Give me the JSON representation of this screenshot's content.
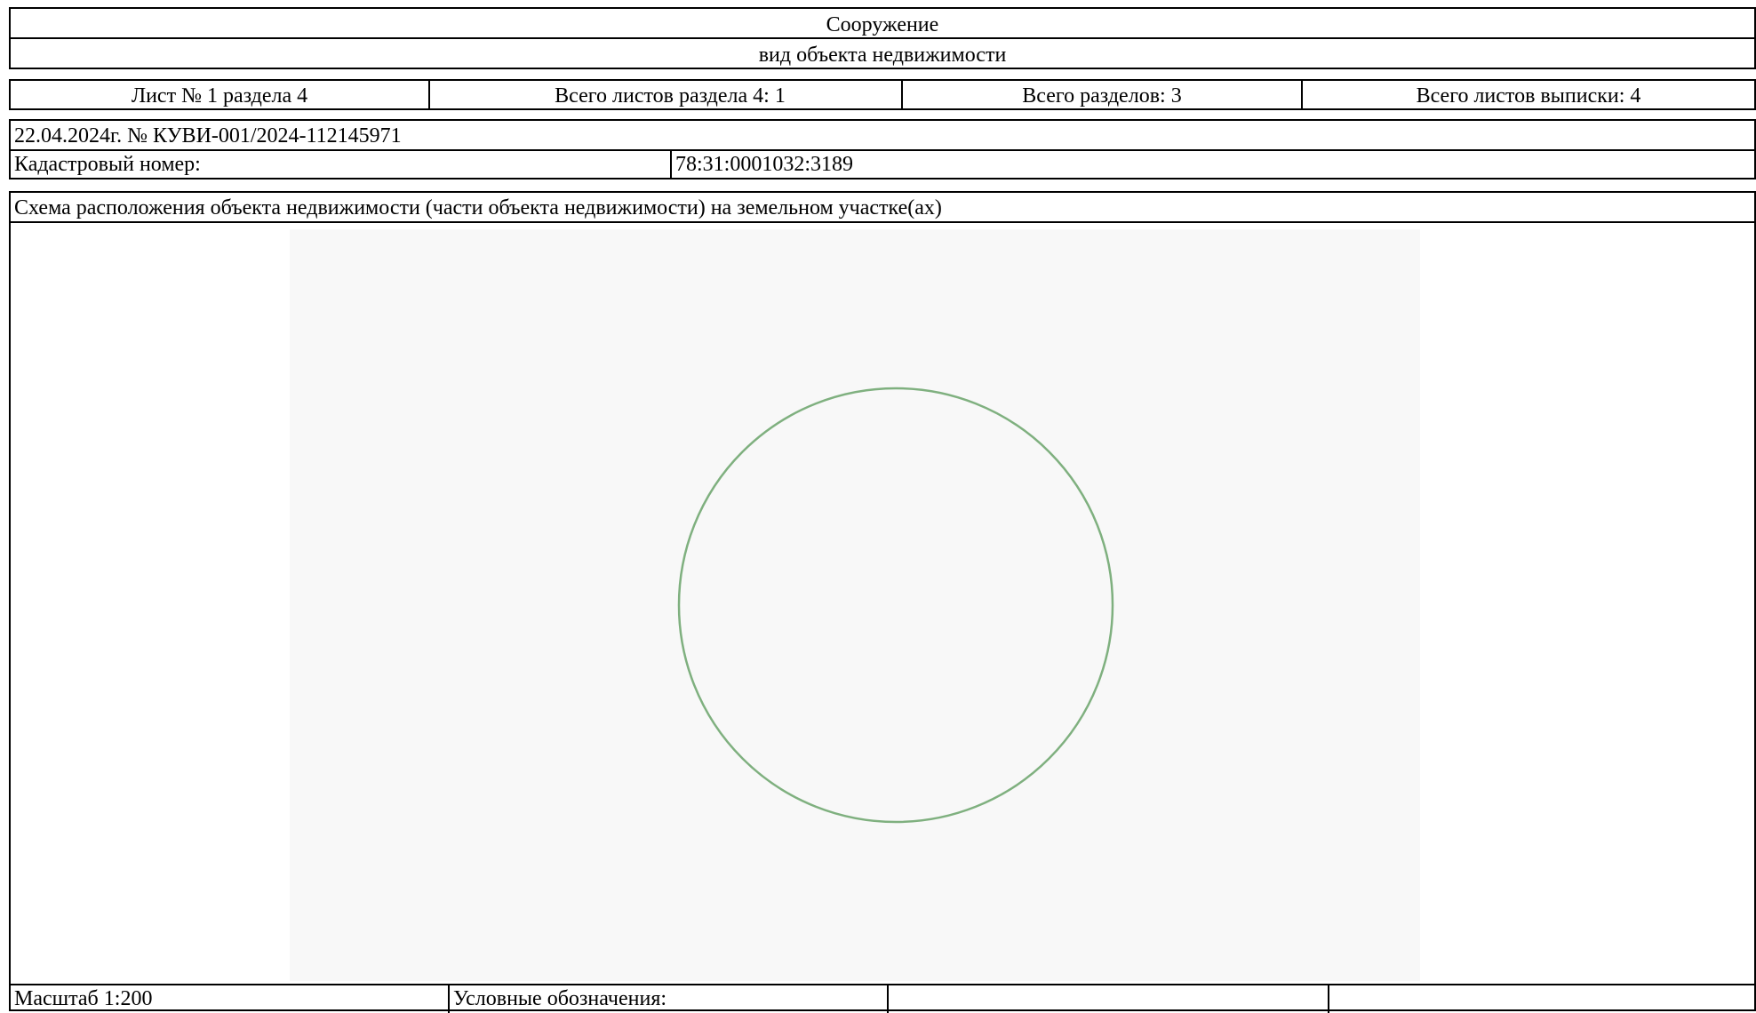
{
  "header": {
    "object_type": "Сооружение",
    "object_type_caption": "вид объекта недвижимости"
  },
  "sheet_info": {
    "sheet_number": "Лист № 1 раздела 4",
    "total_sheets_section": "Всего листов раздела 4: 1",
    "total_sections": "Всего разделов: 3",
    "total_sheets_extract": "Всего листов выписки: 4"
  },
  "record": {
    "date_and_number": "22.04.2024г. № КУВИ-001/2024-112145971",
    "cadastral_label": "Кадастровый номер:",
    "cadastral_value": "78:31:0001032:3189"
  },
  "scheme": {
    "title": "Схема расположения объекта недвижимости (части объекта недвижимости) на земельном участке(ах)",
    "contour_color": "#7fb07f"
  },
  "footer": {
    "scale": "Масштаб 1:200",
    "legend_label": "Условные обозначения:",
    "extra_cell_1": "",
    "extra_cell_2": ""
  }
}
